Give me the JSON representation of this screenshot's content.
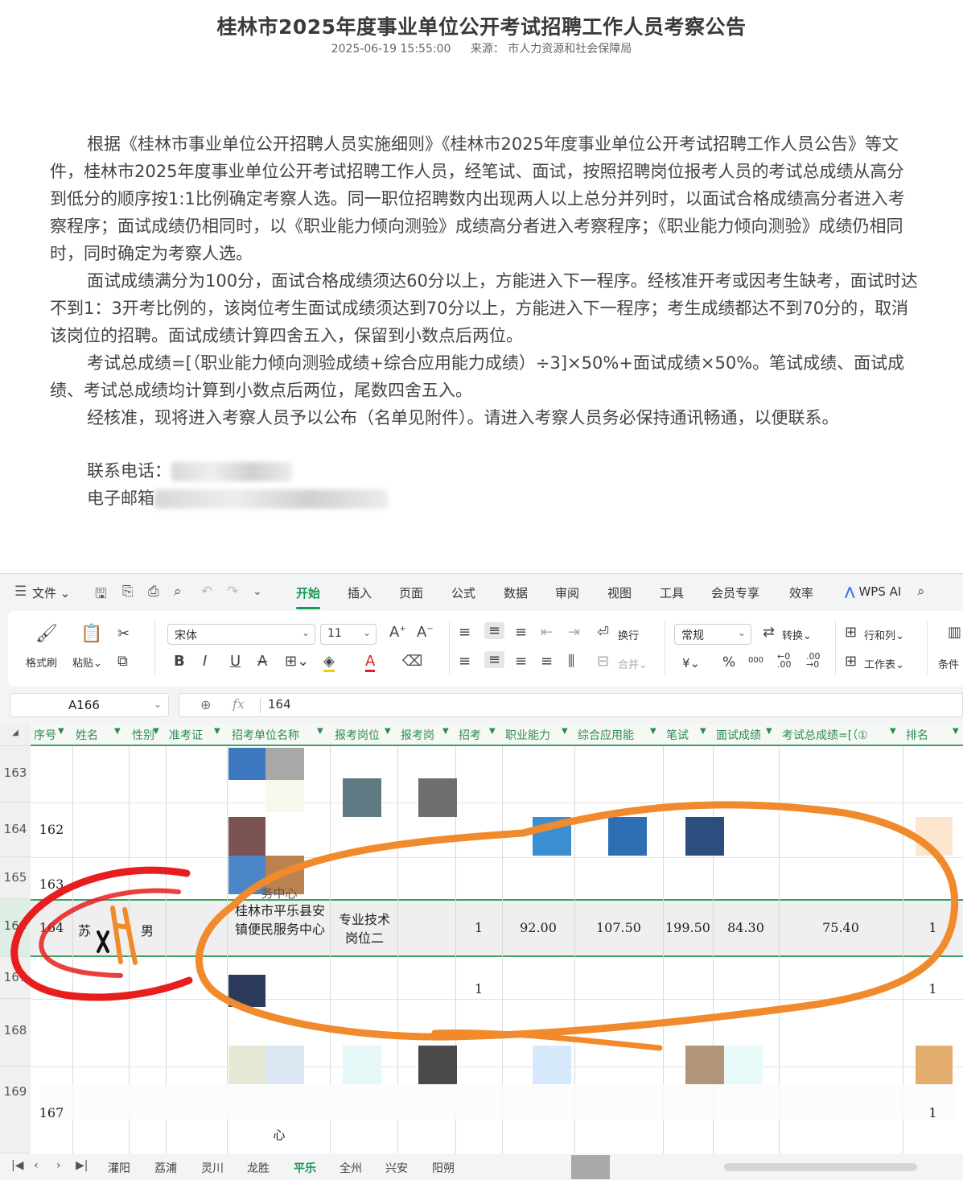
{
  "article": {
    "title": "桂林市2025年度事业单位公开考试招聘工作人员考察公告",
    "datetime": "2025-06-19 15:55:00",
    "source": "来源： 市人力资源和社会保障局",
    "paragraphs": [
      "根据《桂林市事业单位公开招聘人员实施细则》《桂林市2025年度事业单位公开考试招聘工作人员公告》等文件，桂林市2025年度事业单位公开考试招聘工作人员，经笔试、面试，按照招聘岗位报考人员的考试总成绩从高分到低分的顺序按1:1比例确定考察人选。同一职位招聘数内出现两人以上总分并列时，以面试合格成绩高分者进入考察程序；面试成绩仍相同时，以《职业能力倾向测验》成绩高分者进入考察程序；《职业能力倾向测验》成绩仍相同时，同时确定为考察人选。",
      "面试成绩满分为100分，面试合格成绩须达60分以上，方能进入下一程序。经核准开考或因考生缺考，面试时达不到1：3开考比例的，该岗位考生面试成绩须达到70分以上，方能进入下一程序；考生成绩都达不到70分的，取消该岗位的招聘。面试成绩计算四舍五入，保留到小数点后两位。",
      "考试总成绩=[（职业能力倾向测验成绩+综合应用能力成绩）÷3]×50%+面试成绩×50%。笔试成绩、面试成绩、考试总成绩均计算到小数点后两位，尾数四舍五入。",
      "经核准，现将进入考察人员予以公布（名单见附件）。请进入考察人员务必保持通讯畅通，以便联系。"
    ],
    "contact_phone_label": "联系电话：",
    "contact_email_label": "电子邮箱"
  },
  "menubar": {
    "file": "文件",
    "tabs": [
      "开始",
      "插入",
      "页面",
      "公式",
      "数据",
      "审阅",
      "视图",
      "工具",
      "会员专享",
      "效率"
    ],
    "active_tab": "开始",
    "wps_ai": "WPS AI"
  },
  "ribbon": {
    "format_painter": "格式刷",
    "paste": "粘贴",
    "font_name": "宋体",
    "font_size": "11",
    "wrap": "换行",
    "merge": "合并",
    "number_format": "常规",
    "convert": "转换",
    "rows_cols": "行和列",
    "worksheet": "工作表",
    "conditional": "条件",
    "currency": "¥",
    "percent": "%",
    "thousands": "000"
  },
  "formula_bar": {
    "cell_ref": "A166",
    "fx": "fx",
    "value": "164"
  },
  "columns": [
    "序号",
    "姓名",
    "性别",
    "准考证",
    "招考单位名称",
    "报考岗位",
    "报考岗",
    "招考",
    "职业能力",
    "综合应用能",
    "笔试",
    "面试成绩",
    "考试总成绩=[（①",
    "排名"
  ],
  "row_numbers": [
    "163",
    "164",
    "165",
    "166",
    "167",
    "168",
    "169"
  ],
  "visible_cells": {
    "r164_seq": "162",
    "r165_seq": "163",
    "r165_unit_tail": "务中心",
    "r169_seq": "167",
    "r169_unit_tail": "心",
    "r167_recruit": "1",
    "r167_rank": "1",
    "r169_rank": "1"
  },
  "highlight_row": {
    "seq": "164",
    "name": "苏",
    "gender": "男",
    "unit": "桂林市平乐县安镇便民服务中心",
    "post": "专业技术岗位二",
    "recruit": "1",
    "aptitude": "92.00",
    "applied": "107.50",
    "written": "199.50",
    "interview": "84.30",
    "total": "75.40",
    "rank": "1"
  },
  "sheet_tabs": [
    "灌阳",
    "荔浦",
    "灵川",
    "龙胜",
    "平乐",
    "全州",
    "兴安",
    "阳朔"
  ],
  "active_sheet": "平乐",
  "colors": {
    "accent_green": "#1a9a52",
    "annotation_red": "#e81d1d",
    "annotation_orange": "#f08a2c"
  }
}
